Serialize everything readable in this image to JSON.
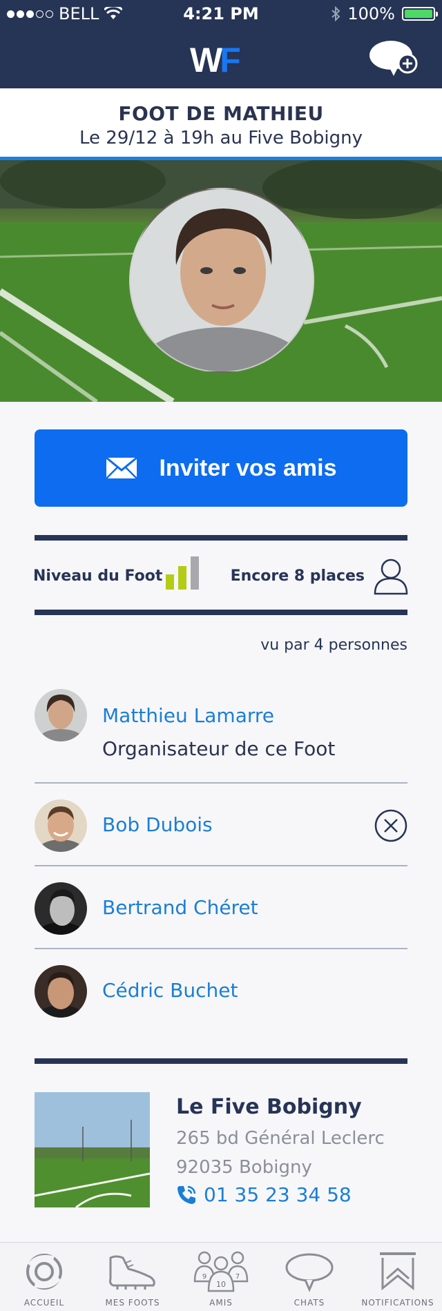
{
  "status_bar": {
    "carrier": "BELL",
    "time": "4:21 PM",
    "battery": "100%"
  },
  "header": {
    "logo_w": "W",
    "logo_f": "F",
    "chat_icon": "new-chat-icon"
  },
  "match": {
    "title": "FOOT DE MATHIEU",
    "subtitle": "Le 29/12 à 19h au Five Bobigny"
  },
  "invite": {
    "label": "Inviter vos amis",
    "icon": "envelope-icon"
  },
  "info": {
    "niveau_label": "Niveau du Foot",
    "niveau_level": 2,
    "niveau_max": 3,
    "places_label": "Encore 8 places",
    "seen_by": "vu par 4 personnes"
  },
  "players": [
    {
      "name": "Matthieu Lamarre",
      "role": "Organisateur de ce Foot"
    },
    {
      "name": "Bob Dubois"
    },
    {
      "name": "Bertrand Chéret"
    },
    {
      "name": "Cédric Buchet"
    }
  ],
  "venue": {
    "name": "Le Five Bobigny",
    "address_line1": "265 bd Général Leclerc",
    "address_line2": "92035 Bobigny",
    "phone": "01 35 23 34 58"
  },
  "tabs": [
    {
      "label": "ACCUEIL",
      "icon": "home-swirl-icon"
    },
    {
      "label": "MES FOOTS",
      "icon": "football-boot-icon"
    },
    {
      "label": "AMIS",
      "icon": "friends-icon",
      "badges": [
        "9",
        "10",
        "7"
      ]
    },
    {
      "label": "CHATS",
      "icon": "chat-bubble-icon"
    },
    {
      "label": "NOTIFICATIONS",
      "icon": "notification-banner-icon"
    }
  ],
  "colors": {
    "navy": "#263455",
    "accent_blue": "#0d6cf0",
    "link_blue": "#1a7ed6",
    "level_green": "#b5cc16",
    "battery_green": "#4cd964"
  }
}
